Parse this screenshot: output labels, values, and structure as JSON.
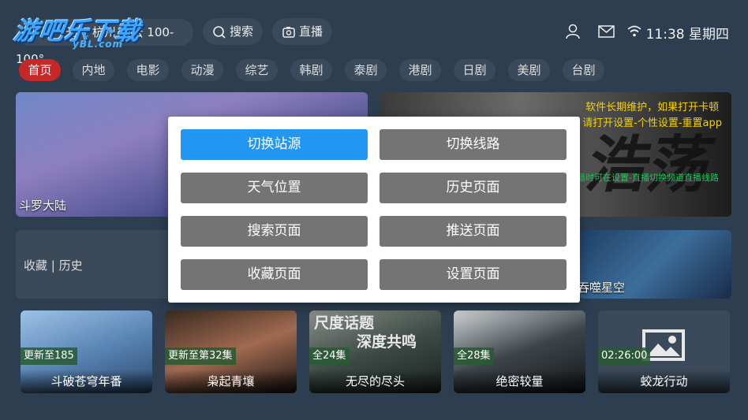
{
  "watermark": {
    "title": "游吧乐下载",
    "subtitle": "yBL.com"
  },
  "header": {
    "weather_text": "天气 杭州 多云 100-100°",
    "search_label": "搜索",
    "live_label": "直播",
    "time": "11:38 星期四",
    "icons": [
      "user-icon",
      "mail-icon",
      "wifi-icon"
    ]
  },
  "nav": {
    "tabs": [
      "首页",
      "内地",
      "电影",
      "动漫",
      "综艺",
      "韩剧",
      "泰剧",
      "港剧",
      "日剧",
      "美剧",
      "台剧"
    ],
    "active": "首页"
  },
  "banners": {
    "left_title": "斗罗大陆",
    "right_notice_line1": "软件长期维护，如果打开卡顿",
    "right_notice_line2": "请打开设置-个性设置-重置app",
    "right_notice_line3": "看直播时可在设置-直播切换频道直播线路",
    "right_char": "浩荡"
  },
  "favorites": {
    "label": "收藏 | 历史"
  },
  "anim_card": {
    "title": "吞噬星空"
  },
  "thumbnails": [
    {
      "badge": "更新至185",
      "title": "斗破苍穹年番"
    },
    {
      "badge": "更新至第32集",
      "title": "枭起青壤"
    },
    {
      "badge": "全24集",
      "title": "无尽的尽头",
      "poster_text_1": "尺度话题",
      "poster_text_2": "深度共鸣"
    },
    {
      "badge": "全28集",
      "title": "绝密较量"
    },
    {
      "badge": "02:26:00",
      "title": "蛟龙行动"
    }
  ],
  "modal": {
    "buttons": [
      {
        "label": "切换站源",
        "selected": true
      },
      {
        "label": "切换线路",
        "selected": false
      },
      {
        "label": "天气位置",
        "selected": false
      },
      {
        "label": "历史页面",
        "selected": false
      },
      {
        "label": "搜索页面",
        "selected": false
      },
      {
        "label": "推送页面",
        "selected": false
      },
      {
        "label": "收藏页面",
        "selected": false
      },
      {
        "label": "设置页面",
        "selected": false
      }
    ]
  },
  "colors": {
    "background": "#2c3e50",
    "active_tab": "#c62828",
    "selected_button": "#2196f3",
    "button": "#747474"
  }
}
